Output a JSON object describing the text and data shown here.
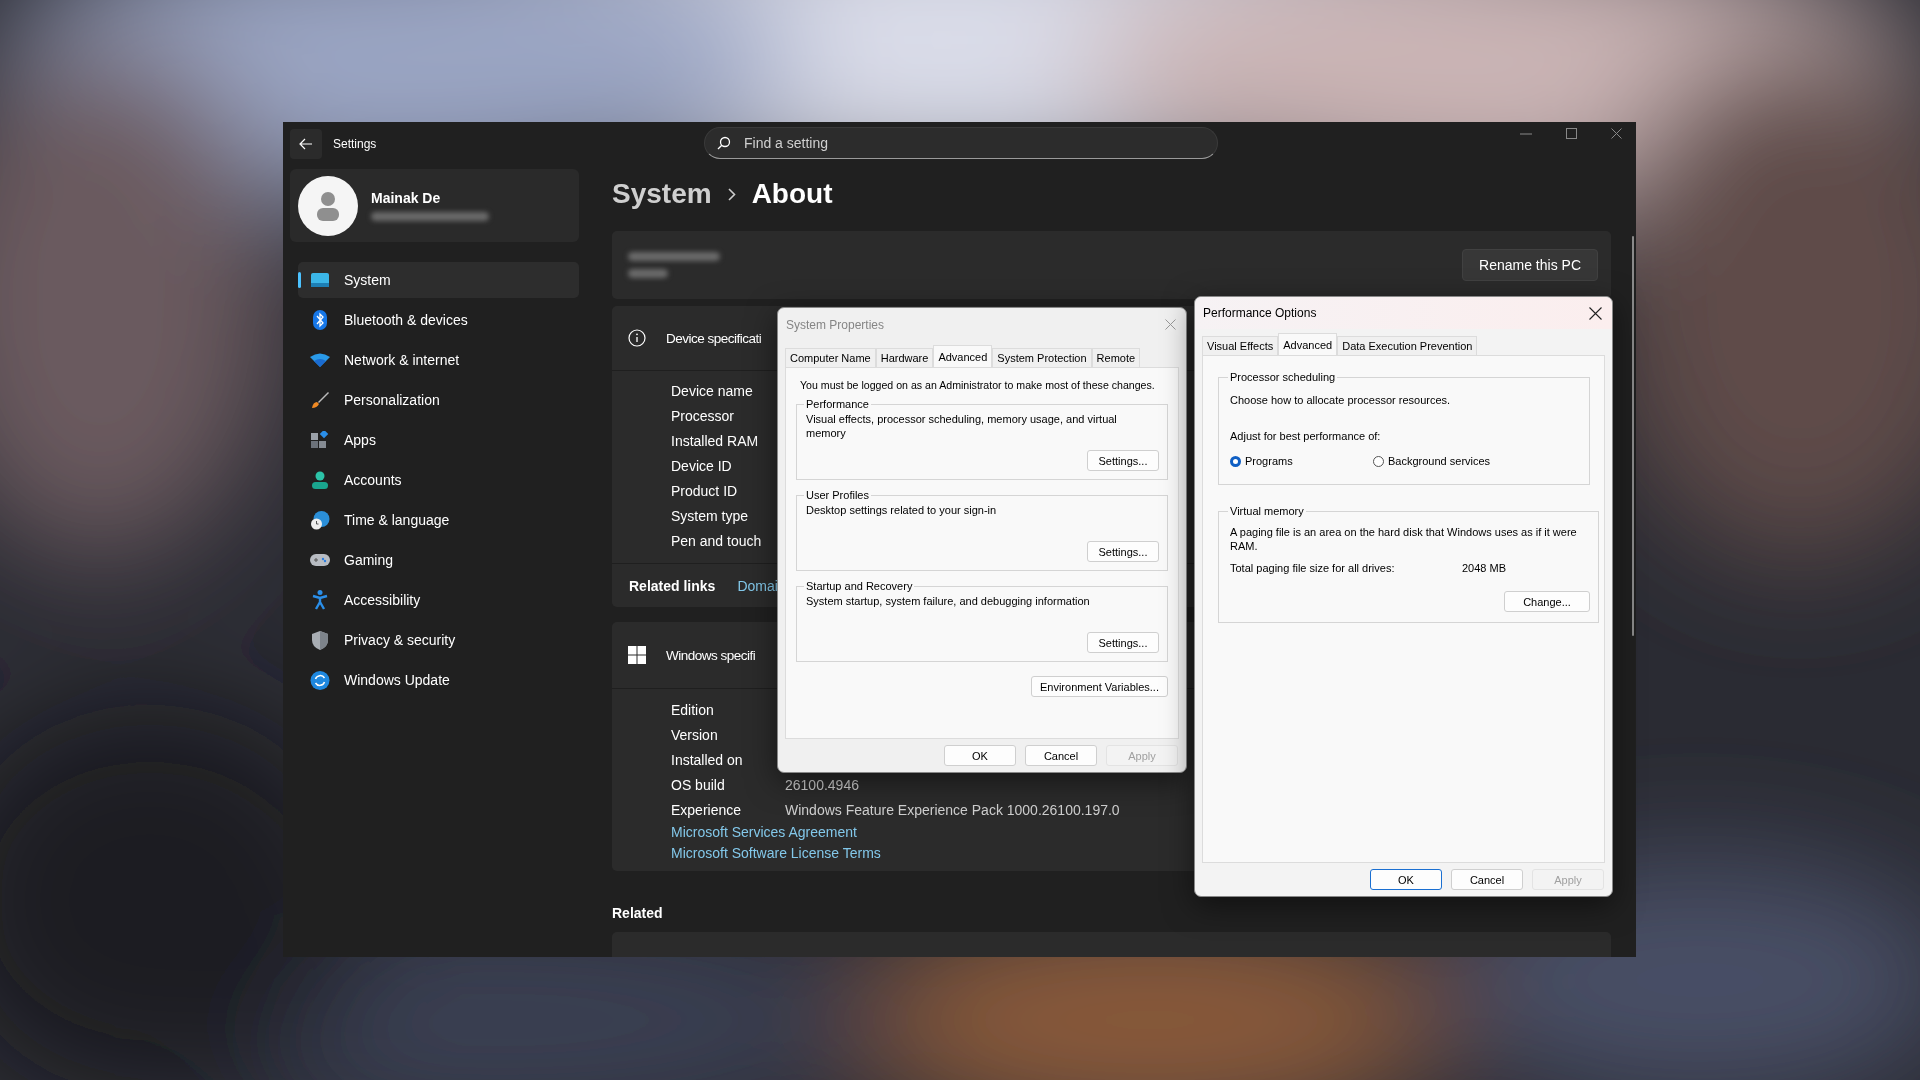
{
  "window": {
    "title": "Settings"
  },
  "search": {
    "placeholder": "Find a setting"
  },
  "profile": {
    "name": "Mainak De"
  },
  "sidebar": {
    "items": [
      {
        "label": "System",
        "selected": true
      },
      {
        "label": "Bluetooth & devices",
        "selected": false
      },
      {
        "label": "Network & internet",
        "selected": false
      },
      {
        "label": "Personalization",
        "selected": false
      },
      {
        "label": "Apps",
        "selected": false
      },
      {
        "label": "Accounts",
        "selected": false
      },
      {
        "label": "Time & language",
        "selected": false
      },
      {
        "label": "Gaming",
        "selected": false
      },
      {
        "label": "Accessibility",
        "selected": false
      },
      {
        "label": "Privacy & security",
        "selected": false
      },
      {
        "label": "Windows Update",
        "selected": false
      }
    ]
  },
  "breadcrumb": {
    "parent": "System",
    "current": "About"
  },
  "pc_card": {
    "button": "Rename this PC"
  },
  "device_specs": {
    "title": "Device specificati",
    "rows": [
      {
        "label": "Device name"
      },
      {
        "label": "Processor"
      },
      {
        "label": "Installed RAM"
      },
      {
        "label": "Device ID"
      },
      {
        "label": "Product ID"
      },
      {
        "label": "System type"
      },
      {
        "label": "Pen and touch"
      }
    ],
    "related_label": "Related links",
    "related_links": [
      "Domai"
    ]
  },
  "windows_specs": {
    "title": "Windows specifi",
    "rows": [
      {
        "label": "Edition"
      },
      {
        "label": "Version"
      },
      {
        "label": "Installed on"
      },
      {
        "label": "OS build",
        "value": "26100.4946"
      },
      {
        "label": "Experience",
        "value": "Windows Feature Experience Pack 1000.26100.197.0"
      }
    ],
    "links": [
      "Microsoft Services Agreement",
      "Microsoft Software License Terms"
    ]
  },
  "related": {
    "title": "Related"
  },
  "system_properties": {
    "title": "System Properties",
    "tabs": [
      {
        "label": "Computer Name",
        "selected": false
      },
      {
        "label": "Hardware",
        "selected": false
      },
      {
        "label": "Advanced",
        "selected": true
      },
      {
        "label": "System Protection",
        "selected": false
      },
      {
        "label": "Remote",
        "selected": false
      }
    ],
    "notice": "You must be logged on as an Administrator to make most of these changes.",
    "groups": [
      {
        "title": "Performance",
        "description": "Visual effects, processor scheduling, memory usage, and virtual memory",
        "button": "Settings..."
      },
      {
        "title": "User Profiles",
        "description": "Desktop settings related to your sign-in",
        "button": "Settings..."
      },
      {
        "title": "Startup and Recovery",
        "description": "System startup, system failure, and debugging information",
        "button": "Settings..."
      }
    ],
    "env_button": "Environment Variables...",
    "buttons": [
      {
        "label": "OK",
        "disabled": false
      },
      {
        "label": "Cancel",
        "disabled": false
      },
      {
        "label": "Apply",
        "disabled": true
      }
    ]
  },
  "performance_options": {
    "title": "Performance Options",
    "tabs": [
      {
        "label": "Visual Effects",
        "selected": false
      },
      {
        "label": "Advanced",
        "selected": true
      },
      {
        "label": "Data Execution Prevention",
        "selected": false
      }
    ],
    "processor_scheduling": {
      "title": "Processor scheduling",
      "description": "Choose how to allocate processor resources.",
      "prompt": "Adjust for best performance of:",
      "options": [
        {
          "label": "Programs",
          "selected": true
        },
        {
          "label": "Background services",
          "selected": false
        }
      ]
    },
    "virtual_memory": {
      "title": "Virtual memory",
      "description": "A paging file is an area on the hard disk that Windows uses as if it were RAM.",
      "total_label": "Total paging file size for all drives:",
      "total_value": "2048 MB",
      "button": "Change..."
    },
    "buttons": [
      {
        "label": "OK",
        "default": true,
        "disabled": false
      },
      {
        "label": "Cancel",
        "default": false,
        "disabled": false
      },
      {
        "label": "Apply",
        "default": false,
        "disabled": true
      }
    ]
  }
}
